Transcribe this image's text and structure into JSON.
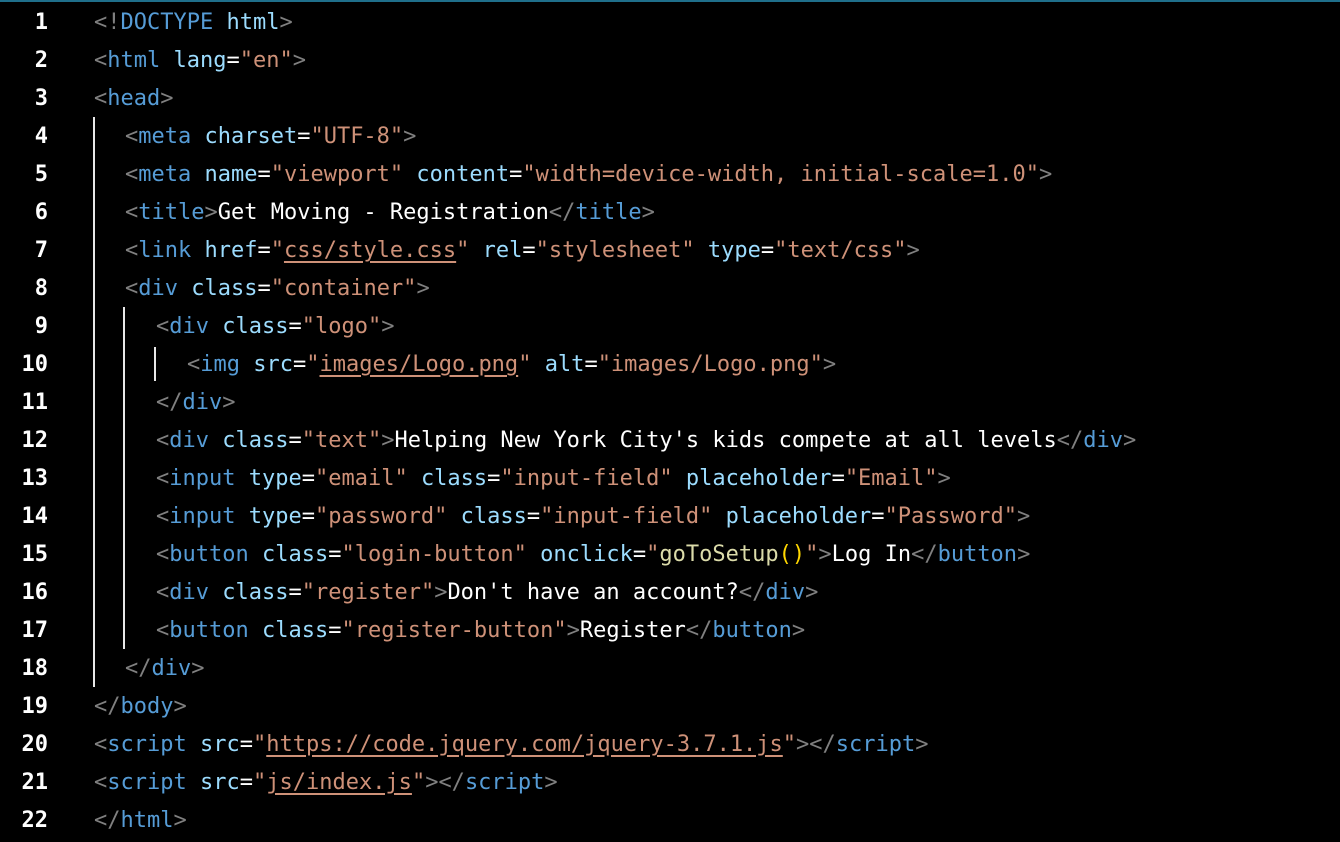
{
  "lines": [
    [
      {
        "t": "<!",
        "c": "punct"
      },
      {
        "t": "DOCTYPE",
        "c": "tag"
      },
      {
        "t": " ",
        "c": "text"
      },
      {
        "t": "html",
        "c": "attr"
      },
      {
        "t": ">",
        "c": "punct"
      }
    ],
    [
      {
        "t": "<",
        "c": "punct"
      },
      {
        "t": "html",
        "c": "tag"
      },
      {
        "t": " ",
        "c": "text"
      },
      {
        "t": "lang",
        "c": "attr"
      },
      {
        "t": "=",
        "c": "text"
      },
      {
        "t": "\"en\"",
        "c": "str"
      },
      {
        "t": ">",
        "c": "punct"
      }
    ],
    [
      {
        "t": "<",
        "c": "punct"
      },
      {
        "t": "head",
        "c": "tag"
      },
      {
        "t": ">",
        "c": "punct"
      }
    ],
    [
      {
        "t": "<",
        "c": "punct"
      },
      {
        "t": "meta",
        "c": "tag"
      },
      {
        "t": " ",
        "c": "text"
      },
      {
        "t": "charset",
        "c": "attr"
      },
      {
        "t": "=",
        "c": "text"
      },
      {
        "t": "\"UTF-8\"",
        "c": "str"
      },
      {
        "t": ">",
        "c": "punct"
      }
    ],
    [
      {
        "t": "<",
        "c": "punct"
      },
      {
        "t": "meta",
        "c": "tag"
      },
      {
        "t": " ",
        "c": "text"
      },
      {
        "t": "name",
        "c": "attr"
      },
      {
        "t": "=",
        "c": "text"
      },
      {
        "t": "\"viewport\"",
        "c": "str"
      },
      {
        "t": " ",
        "c": "text"
      },
      {
        "t": "content",
        "c": "attr"
      },
      {
        "t": "=",
        "c": "text"
      },
      {
        "t": "\"width=device-width, initial-scale=1.0\"",
        "c": "str"
      },
      {
        "t": ">",
        "c": "punct"
      }
    ],
    [
      {
        "t": "<",
        "c": "punct"
      },
      {
        "t": "title",
        "c": "tag"
      },
      {
        "t": ">",
        "c": "punct"
      },
      {
        "t": "Get Moving - Registration",
        "c": "text"
      },
      {
        "t": "</",
        "c": "punct"
      },
      {
        "t": "title",
        "c": "tag"
      },
      {
        "t": ">",
        "c": "punct"
      }
    ],
    [
      {
        "t": "<",
        "c": "punct"
      },
      {
        "t": "link",
        "c": "tag"
      },
      {
        "t": " ",
        "c": "text"
      },
      {
        "t": "href",
        "c": "attr"
      },
      {
        "t": "=",
        "c": "text"
      },
      {
        "t": "\"",
        "c": "str"
      },
      {
        "t": "css/style.css",
        "c": "str",
        "u": true
      },
      {
        "t": "\"",
        "c": "str"
      },
      {
        "t": " ",
        "c": "text"
      },
      {
        "t": "rel",
        "c": "attr"
      },
      {
        "t": "=",
        "c": "text"
      },
      {
        "t": "\"stylesheet\"",
        "c": "str"
      },
      {
        "t": " ",
        "c": "text"
      },
      {
        "t": "type",
        "c": "attr"
      },
      {
        "t": "=",
        "c": "text"
      },
      {
        "t": "\"text/css\"",
        "c": "str"
      },
      {
        "t": ">",
        "c": "punct"
      }
    ],
    [
      {
        "t": "<",
        "c": "punct"
      },
      {
        "t": "div",
        "c": "tag"
      },
      {
        "t": " ",
        "c": "text"
      },
      {
        "t": "class",
        "c": "attr"
      },
      {
        "t": "=",
        "c": "text"
      },
      {
        "t": "\"container\"",
        "c": "str"
      },
      {
        "t": ">",
        "c": "punct"
      }
    ],
    [
      {
        "t": "<",
        "c": "punct"
      },
      {
        "t": "div",
        "c": "tag"
      },
      {
        "t": " ",
        "c": "text"
      },
      {
        "t": "class",
        "c": "attr"
      },
      {
        "t": "=",
        "c": "text"
      },
      {
        "t": "\"logo\"",
        "c": "str"
      },
      {
        "t": ">",
        "c": "punct"
      }
    ],
    [
      {
        "t": "<",
        "c": "punct"
      },
      {
        "t": "img",
        "c": "tag"
      },
      {
        "t": " ",
        "c": "text"
      },
      {
        "t": "src",
        "c": "attr"
      },
      {
        "t": "=",
        "c": "text"
      },
      {
        "t": "\"",
        "c": "str"
      },
      {
        "t": "images/Logo.png",
        "c": "str",
        "u": true
      },
      {
        "t": "\"",
        "c": "str"
      },
      {
        "t": " ",
        "c": "text"
      },
      {
        "t": "alt",
        "c": "attr"
      },
      {
        "t": "=",
        "c": "text"
      },
      {
        "t": "\"images/Logo.png\"",
        "c": "str"
      },
      {
        "t": ">",
        "c": "punct"
      }
    ],
    [
      {
        "t": "</",
        "c": "punct"
      },
      {
        "t": "div",
        "c": "tag"
      },
      {
        "t": ">",
        "c": "punct"
      }
    ],
    [
      {
        "t": "<",
        "c": "punct"
      },
      {
        "t": "div",
        "c": "tag"
      },
      {
        "t": " ",
        "c": "text"
      },
      {
        "t": "class",
        "c": "attr"
      },
      {
        "t": "=",
        "c": "text"
      },
      {
        "t": "\"text\"",
        "c": "str"
      },
      {
        "t": ">",
        "c": "punct"
      },
      {
        "t": "Helping New York City's kids compete at all levels",
        "c": "text"
      },
      {
        "t": "</",
        "c": "punct"
      },
      {
        "t": "div",
        "c": "tag"
      },
      {
        "t": ">",
        "c": "punct"
      }
    ],
    [
      {
        "t": "<",
        "c": "punct"
      },
      {
        "t": "input",
        "c": "tag"
      },
      {
        "t": " ",
        "c": "text"
      },
      {
        "t": "type",
        "c": "attr"
      },
      {
        "t": "=",
        "c": "text"
      },
      {
        "t": "\"email\"",
        "c": "str"
      },
      {
        "t": " ",
        "c": "text"
      },
      {
        "t": "class",
        "c": "attr"
      },
      {
        "t": "=",
        "c": "text"
      },
      {
        "t": "\"input-field\"",
        "c": "str"
      },
      {
        "t": " ",
        "c": "text"
      },
      {
        "t": "placeholder",
        "c": "attr"
      },
      {
        "t": "=",
        "c": "text"
      },
      {
        "t": "\"Email\"",
        "c": "str"
      },
      {
        "t": ">",
        "c": "punct"
      }
    ],
    [
      {
        "t": "<",
        "c": "punct"
      },
      {
        "t": "input",
        "c": "tag"
      },
      {
        "t": " ",
        "c": "text"
      },
      {
        "t": "type",
        "c": "attr"
      },
      {
        "t": "=",
        "c": "text"
      },
      {
        "t": "\"password\"",
        "c": "str"
      },
      {
        "t": " ",
        "c": "text"
      },
      {
        "t": "class",
        "c": "attr"
      },
      {
        "t": "=",
        "c": "text"
      },
      {
        "t": "\"input-field\"",
        "c": "str"
      },
      {
        "t": " ",
        "c": "text"
      },
      {
        "t": "placeholder",
        "c": "attr"
      },
      {
        "t": "=",
        "c": "text"
      },
      {
        "t": "\"Password\"",
        "c": "str"
      },
      {
        "t": ">",
        "c": "punct"
      }
    ],
    [
      {
        "t": "<",
        "c": "punct"
      },
      {
        "t": "button",
        "c": "tag"
      },
      {
        "t": " ",
        "c": "text"
      },
      {
        "t": "class",
        "c": "attr"
      },
      {
        "t": "=",
        "c": "text"
      },
      {
        "t": "\"login-button\"",
        "c": "str"
      },
      {
        "t": " ",
        "c": "text"
      },
      {
        "t": "onclick",
        "c": "attr"
      },
      {
        "t": "=",
        "c": "text"
      },
      {
        "t": "\"",
        "c": "str"
      },
      {
        "t": "goToSetup",
        "c": "fn"
      },
      {
        "t": "()",
        "c": "paren"
      },
      {
        "t": "\"",
        "c": "str"
      },
      {
        "t": ">",
        "c": "punct"
      },
      {
        "t": "Log In",
        "c": "text"
      },
      {
        "t": "</",
        "c": "punct"
      },
      {
        "t": "button",
        "c": "tag"
      },
      {
        "t": ">",
        "c": "punct"
      }
    ],
    [
      {
        "t": "<",
        "c": "punct"
      },
      {
        "t": "div",
        "c": "tag"
      },
      {
        "t": " ",
        "c": "text"
      },
      {
        "t": "class",
        "c": "attr"
      },
      {
        "t": "=",
        "c": "text"
      },
      {
        "t": "\"register\"",
        "c": "str"
      },
      {
        "t": ">",
        "c": "punct"
      },
      {
        "t": "Don't have an account?",
        "c": "text"
      },
      {
        "t": "</",
        "c": "punct"
      },
      {
        "t": "div",
        "c": "tag"
      },
      {
        "t": ">",
        "c": "punct"
      }
    ],
    [
      {
        "t": "<",
        "c": "punct"
      },
      {
        "t": "button",
        "c": "tag"
      },
      {
        "t": " ",
        "c": "text"
      },
      {
        "t": "class",
        "c": "attr"
      },
      {
        "t": "=",
        "c": "text"
      },
      {
        "t": "\"register-button\"",
        "c": "str"
      },
      {
        "t": ">",
        "c": "punct"
      },
      {
        "t": "Register",
        "c": "text"
      },
      {
        "t": "</",
        "c": "punct"
      },
      {
        "t": "button",
        "c": "tag"
      },
      {
        "t": ">",
        "c": "punct"
      }
    ],
    [
      {
        "t": "</",
        "c": "punct"
      },
      {
        "t": "div",
        "c": "tag"
      },
      {
        "t": ">",
        "c": "punct"
      }
    ],
    [
      {
        "t": "</",
        "c": "punct"
      },
      {
        "t": "body",
        "c": "tag"
      },
      {
        "t": ">",
        "c": "punct"
      }
    ],
    [
      {
        "t": "<",
        "c": "punct"
      },
      {
        "t": "script",
        "c": "tag"
      },
      {
        "t": " ",
        "c": "text"
      },
      {
        "t": "src",
        "c": "attr"
      },
      {
        "t": "=",
        "c": "text"
      },
      {
        "t": "\"",
        "c": "str"
      },
      {
        "t": "https://code.jquery.com/jquery-3.7.1.js",
        "c": "str",
        "u": true
      },
      {
        "t": "\"",
        "c": "str"
      },
      {
        "t": ">",
        "c": "punct"
      },
      {
        "t": "</",
        "c": "punct"
      },
      {
        "t": "script",
        "c": "tag"
      },
      {
        "t": ">",
        "c": "punct"
      }
    ],
    [
      {
        "t": "<",
        "c": "punct"
      },
      {
        "t": "script",
        "c": "tag"
      },
      {
        "t": " ",
        "c": "text"
      },
      {
        "t": "src",
        "c": "attr"
      },
      {
        "t": "=",
        "c": "text"
      },
      {
        "t": "\"",
        "c": "str"
      },
      {
        "t": "js/index.js",
        "c": "str",
        "u": true
      },
      {
        "t": "\"",
        "c": "str"
      },
      {
        "t": ">",
        "c": "punct"
      },
      {
        "t": "</",
        "c": "punct"
      },
      {
        "t": "script",
        "c": "tag"
      },
      {
        "t": ">",
        "c": "punct"
      }
    ],
    [
      {
        "t": "</",
        "c": "punct"
      },
      {
        "t": "html",
        "c": "tag"
      },
      {
        "t": ">",
        "c": "punct"
      }
    ]
  ],
  "line_numbers": [
    "1",
    "2",
    "3",
    "4",
    "5",
    "6",
    "7",
    "8",
    "9",
    "10",
    "11",
    "12",
    "13",
    "14",
    "15",
    "16",
    "17",
    "18",
    "19",
    "20",
    "21",
    "22"
  ],
  "indent_levels": [
    0,
    0,
    0,
    1,
    1,
    1,
    1,
    1,
    2,
    3,
    2,
    2,
    2,
    2,
    2,
    2,
    2,
    1,
    0,
    0,
    0,
    0
  ]
}
